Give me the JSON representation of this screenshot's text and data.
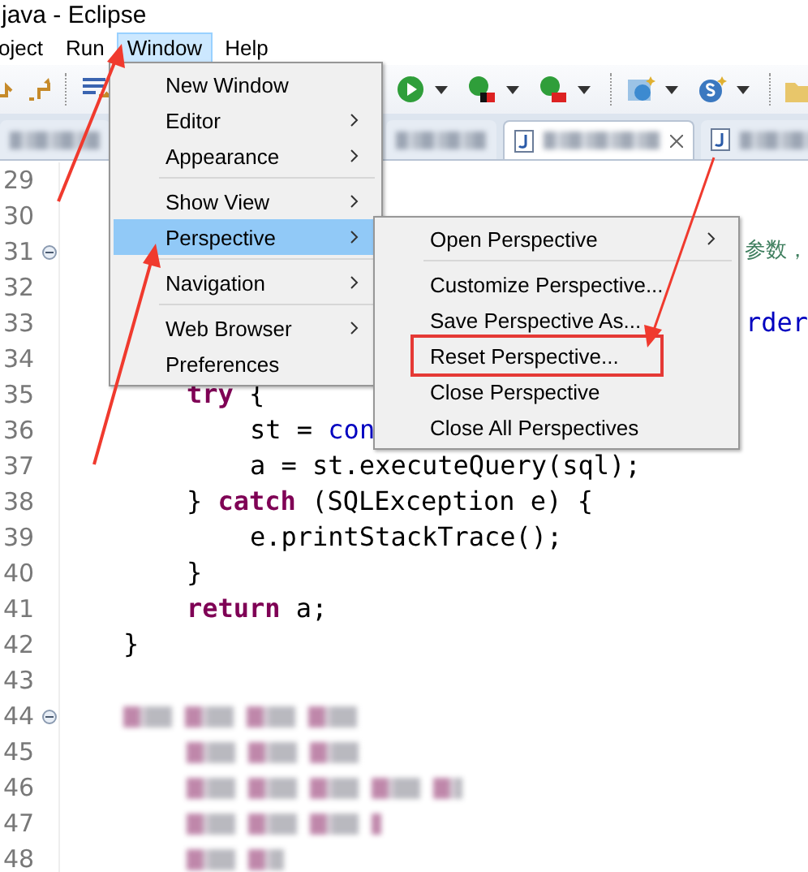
{
  "window": {
    "title": "java - Eclipse"
  },
  "menu_bar": [
    {
      "label": "oject",
      "selected": false
    },
    {
      "label": "Run",
      "selected": false
    },
    {
      "label": "Window",
      "selected": true
    },
    {
      "label": "Help",
      "selected": false
    }
  ],
  "editor_tabs": [
    {
      "selected": false
    },
    {
      "selected": false
    },
    {
      "selected": true
    },
    {
      "selected": false
    }
  ],
  "editor": {
    "lines": [
      {
        "number": "29",
        "kind": "code"
      },
      {
        "number": "30",
        "kind": "code"
      },
      {
        "number": "31",
        "kind": "code",
        "fold": true,
        "tail": {
          "kind": "comment",
          "text": "参数，"
        }
      },
      {
        "number": "32",
        "kind": "code"
      },
      {
        "number": "33",
        "kind": "code",
        "tail": {
          "kind": "field",
          "text": "rder"
        }
      },
      {
        "number": "34",
        "kind": "code"
      },
      {
        "number": "35",
        "kind": "code",
        "segments": [
          {
            "kind": "keyword",
            "text": "try"
          },
          {
            "kind": "plain",
            "text": " {"
          }
        ]
      },
      {
        "number": "36",
        "kind": "code",
        "segments": [
          {
            "kind": "plain",
            "text": "st = "
          },
          {
            "kind": "field",
            "text": "con"
          }
        ]
      },
      {
        "number": "37",
        "kind": "code",
        "segments": [
          {
            "kind": "plain",
            "text": "a = st.executeQuery(sql);"
          }
        ]
      },
      {
        "number": "38",
        "kind": "code",
        "segments": [
          {
            "kind": "plain",
            "text": "} "
          },
          {
            "kind": "keyword",
            "text": "catch"
          },
          {
            "kind": "plain",
            "text": " (SQLException e) {"
          }
        ]
      },
      {
        "number": "39",
        "kind": "code",
        "segments": [
          {
            "kind": "plain",
            "text": "e.printStackTrace();"
          }
        ]
      },
      {
        "number": "40",
        "kind": "code",
        "segments": [
          {
            "kind": "plain",
            "text": "}"
          }
        ]
      },
      {
        "number": "41",
        "kind": "code",
        "segments": [
          {
            "kind": "keyword",
            "text": "return"
          },
          {
            "kind": "plain",
            "text": " a;"
          }
        ]
      },
      {
        "number": "42",
        "kind": "code",
        "segments": [
          {
            "kind": "plain",
            "text": "}"
          }
        ]
      },
      {
        "number": "43",
        "kind": "code"
      },
      {
        "number": "44",
        "kind": "blurred",
        "fold": true
      },
      {
        "number": "45",
        "kind": "blurred"
      },
      {
        "number": "46",
        "kind": "blurred"
      },
      {
        "number": "47",
        "kind": "blurred"
      },
      {
        "number": "48",
        "kind": "blurred"
      }
    ]
  },
  "window_menu": {
    "items": [
      {
        "kind": "item",
        "label": "New Window",
        "submenu": false,
        "selected": false
      },
      {
        "kind": "item",
        "label": "Editor",
        "submenu": true,
        "selected": false
      },
      {
        "kind": "item",
        "label": "Appearance",
        "submenu": true,
        "selected": false
      },
      {
        "kind": "separator"
      },
      {
        "kind": "item",
        "label": "Show View",
        "submenu": true,
        "selected": false
      },
      {
        "kind": "item",
        "label": "Perspective",
        "submenu": true,
        "selected": true
      },
      {
        "kind": "separator"
      },
      {
        "kind": "item",
        "label": "Navigation",
        "submenu": true,
        "selected": false
      },
      {
        "kind": "separator"
      },
      {
        "kind": "item",
        "label": "Web Browser",
        "submenu": true,
        "selected": false
      },
      {
        "kind": "item",
        "label": "Preferences",
        "submenu": false,
        "selected": false
      }
    ]
  },
  "perspective_submenu": {
    "items": [
      {
        "kind": "item",
        "label": "Open Perspective",
        "submenu": true,
        "highlighted": false
      },
      {
        "kind": "separator"
      },
      {
        "kind": "item",
        "label": "Customize Perspective...",
        "submenu": false,
        "highlighted": false
      },
      {
        "kind": "item",
        "label": "Save Perspective As...",
        "submenu": false,
        "highlighted": false
      },
      {
        "kind": "item",
        "label": "Reset Perspective...",
        "submenu": false,
        "highlighted": true
      },
      {
        "kind": "item",
        "label": "Close Perspective",
        "submenu": false,
        "highlighted": false
      },
      {
        "kind": "item",
        "label": "Close All Perspectives",
        "submenu": false,
        "highlighted": false
      }
    ]
  }
}
